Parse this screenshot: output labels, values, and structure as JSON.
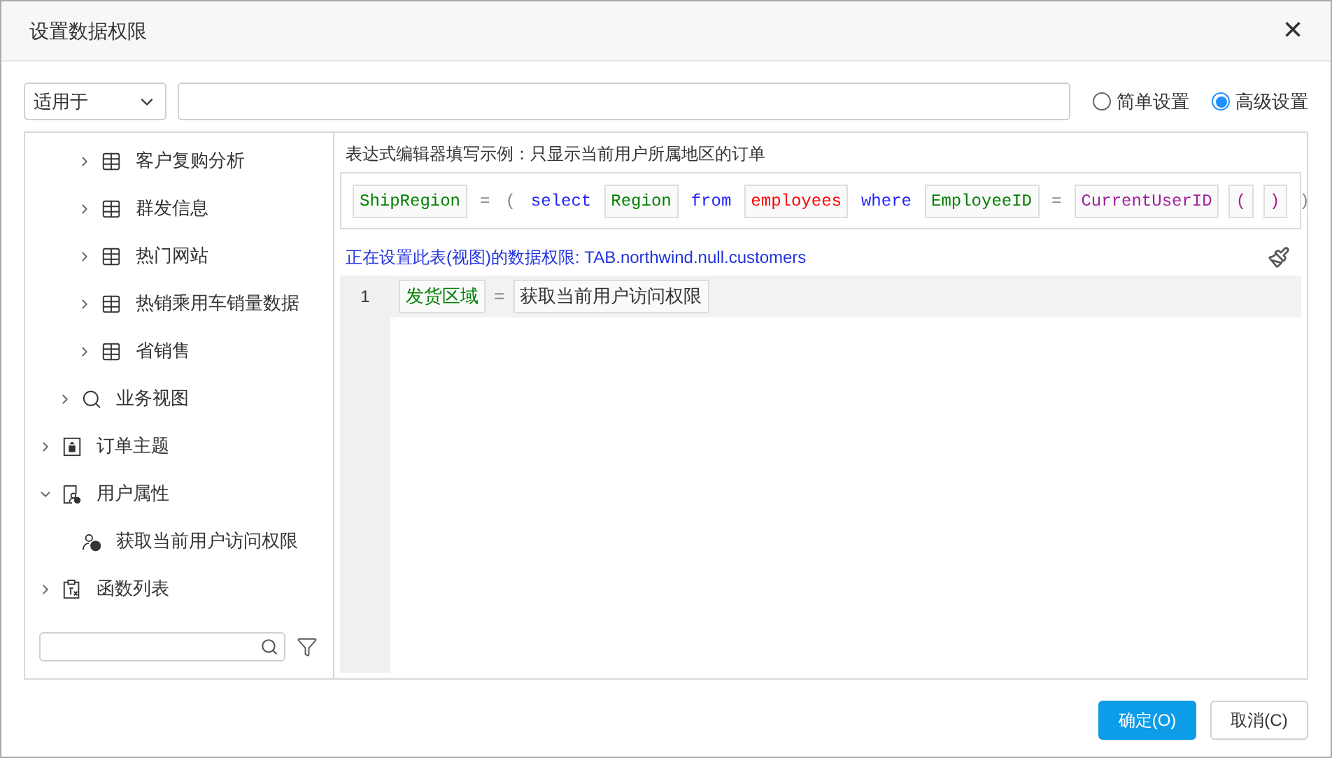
{
  "window": {
    "title": "设置数据权限",
    "close": "×"
  },
  "scope": {
    "value": "适用于"
  },
  "modes": [
    {
      "label": "简单设置",
      "selected": false
    },
    {
      "label": "高级设置",
      "selected": true
    }
  ],
  "tree": [
    {
      "children": [
        {
          "children": [
            {
              "label": "客户复购分析",
              "kind": "table",
              "expanded": false
            },
            {
              "label": "群发信息",
              "kind": "table",
              "expanded": false
            },
            {
              "label": "热门网站",
              "kind": "table",
              "expanded": false
            },
            {
              "label": "热销乘用车销量数据",
              "kind": "table",
              "expanded": false
            },
            {
              "label": "省销售",
              "kind": "table",
              "expanded": false
            }
          ]
        },
        {
          "label": "业务视图",
          "kind": "search",
          "expanded": false
        }
      ]
    },
    {
      "label": "订单主题",
      "kind": "subject",
      "expanded": false
    },
    {
      "label": "用户属性",
      "kind": "attribute",
      "expanded": true,
      "children": [
        {
          "label": "获取当前用户访问权限",
          "kind": "userfunc"
        }
      ]
    },
    {
      "label": "函数列表",
      "kind": "function",
      "expanded": false
    }
  ],
  "example": {
    "caption": "表达式编辑器填写示例：只显示当前用户所属地区的订单",
    "tokens": [
      {
        "text": "ShipRegion",
        "kind": "field"
      },
      {
        "text": "=",
        "kind": "op"
      },
      {
        "text": "(",
        "kind": "op"
      },
      {
        "text": "select",
        "kind": "keyword"
      },
      {
        "text": "Region",
        "kind": "field"
      },
      {
        "text": "from",
        "kind": "keyword"
      },
      {
        "text": "employees",
        "kind": "table"
      },
      {
        "text": "where",
        "kind": "keyword"
      },
      {
        "text": "EmployeeID",
        "kind": "field"
      },
      {
        "text": "=",
        "kind": "op"
      },
      {
        "text": "CurrentUserID",
        "kind": "func"
      },
      {
        "text": "(",
        "kind": "func"
      },
      {
        "text": ")",
        "kind": "func"
      },
      {
        "text": ")",
        "kind": "op"
      }
    ]
  },
  "editor": {
    "status": "正在设置此表(视图)的数据权限: TAB.northwind.null.customers",
    "lines": [
      {
        "number": "1",
        "tokens": [
          {
            "text": "发货区域",
            "kind": "field"
          },
          {
            "text": "=",
            "kind": "op"
          },
          {
            "text": "获取当前用户访问权限",
            "kind": "value"
          }
        ]
      }
    ]
  },
  "buttons": [
    {
      "label": "确定(O)",
      "primary": true
    },
    {
      "label": "取消(C)",
      "primary": false
    }
  ]
}
